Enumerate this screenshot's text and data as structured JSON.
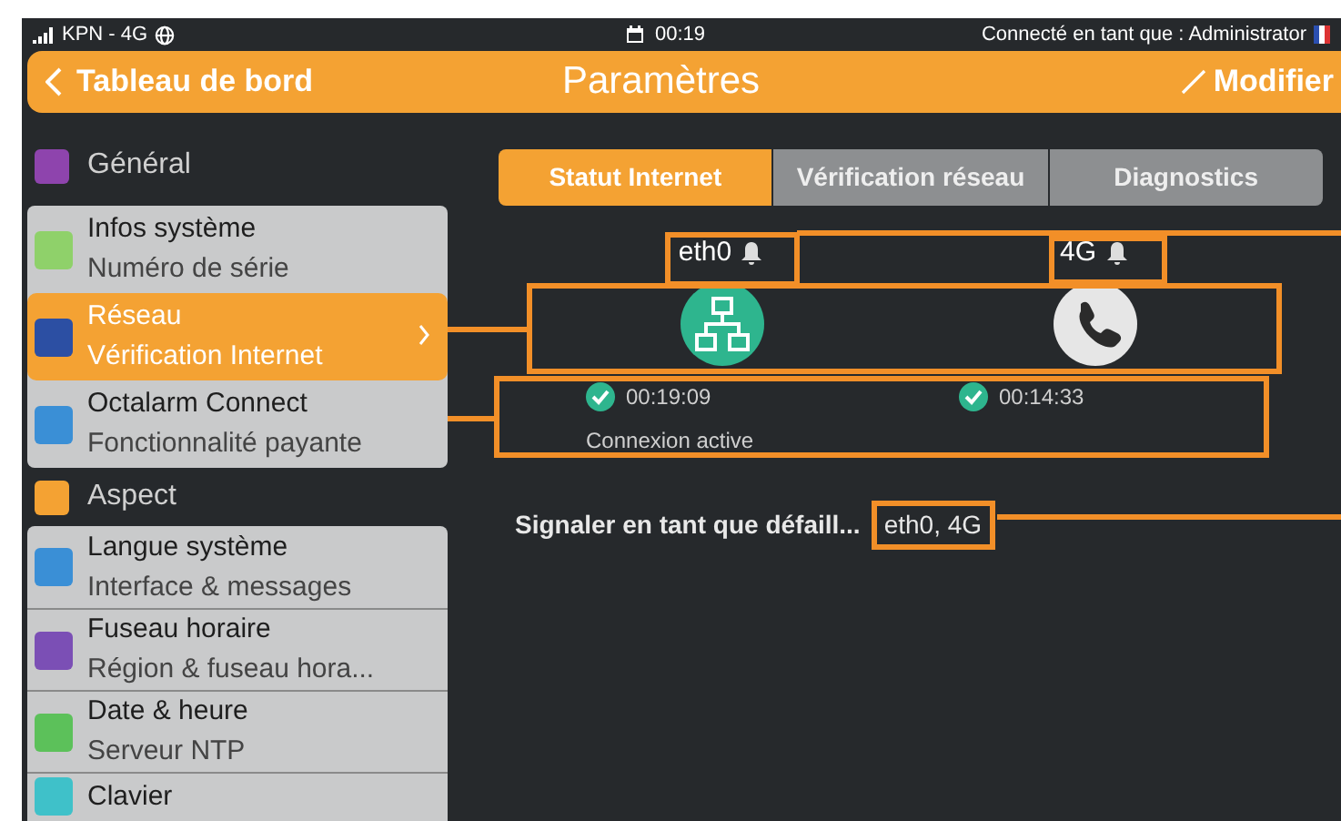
{
  "status_bar": {
    "carrier": "KPN - 4G",
    "time": "00:19",
    "user": "Connecté en tant que : Administrator"
  },
  "header": {
    "back": "Tableau de bord",
    "title": "Paramètres",
    "action": "Modifier"
  },
  "sidebar": {
    "sections": [
      {
        "title": "Général",
        "color": "#8e44ad",
        "items": [
          {
            "title": "Infos système",
            "subtitle": "Numéro de série",
            "color": "#8fd16a",
            "selected": false
          },
          {
            "title": "Réseau",
            "subtitle": "Vérification Internet",
            "color": "#2c4fa3",
            "selected": true
          },
          {
            "title": "Octalarm Connect",
            "subtitle": "Fonctionnalité payante",
            "color": "#3a8fd6",
            "selected": false
          }
        ]
      },
      {
        "title": "Aspect",
        "color": "#f4a233",
        "items": [
          {
            "title": "Langue système",
            "subtitle": "Interface & messages",
            "color": "#3a8fd6",
            "selected": false
          },
          {
            "title": "Fuseau horaire",
            "subtitle": "Région & fuseau hora...",
            "color": "#7b4fb5",
            "selected": false
          },
          {
            "title": "Date & heure",
            "subtitle": "Serveur NTP",
            "color": "#5cc15a",
            "selected": false
          },
          {
            "title": "Clavier",
            "color": "#3fc1c9",
            "selected": false
          }
        ]
      }
    ]
  },
  "tabs": [
    {
      "label": "Statut Internet",
      "selected": true
    },
    {
      "label": "Vérification réseau",
      "selected": false
    },
    {
      "label": "Diagnostics",
      "selected": false
    }
  ],
  "interfaces": [
    {
      "name": "eth0",
      "kind": "network",
      "active": true,
      "time": "00:19:09",
      "status": "Connexion active"
    },
    {
      "name": "4G",
      "kind": "phone",
      "active": false,
      "time": "00:14:33"
    }
  ],
  "default_report": {
    "label": "Signaler en tant que défaill...",
    "value": "eth0, 4G"
  }
}
